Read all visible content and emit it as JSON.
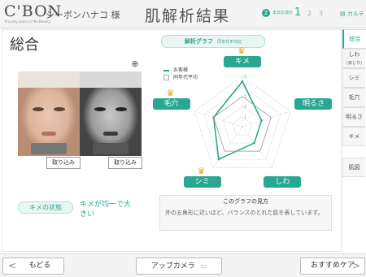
{
  "header": {
    "logo": "C'BON",
    "logo_sub": "It's only yours in the Beauty",
    "customer_name": "シーボンハナコ 様",
    "page_title": "肌解析結果",
    "step_label": "本日の流れ",
    "steps": [
      "1",
      "2",
      "3"
    ],
    "cart_label": "カルテ",
    "accent_color": "#2aa790"
  },
  "main": {
    "section_title": "総合",
    "photo_buttons": [
      "取り込み",
      "取り込み"
    ],
    "kime_badge": "キメの状態",
    "kime_result": "キメが均一で大きい"
  },
  "graph": {
    "header_title": "解析グラフ",
    "header_sub": "同年代平均比",
    "legend_customer": "お客様",
    "legend_average": "同年代平均",
    "explain_title": "このグラフの見方",
    "explain_body": "外の五角形に近いほど、バランスのとれた肌を表しています。"
  },
  "chart_data": {
    "type": "radar",
    "categories": [
      "キメ",
      "明るさ",
      "しわ",
      "シミ",
      "毛穴"
    ],
    "scale_labels": [
      "1",
      "2",
      "3",
      "4",
      "5"
    ],
    "range": [
      0,
      5
    ],
    "series": [
      {
        "name": "お客様",
        "values": [
          4.5,
          2.0,
          2.0,
          4.0,
          3.0
        ]
      },
      {
        "name": "同年代平均",
        "values": [
          3,
          3,
          3,
          3,
          3
        ]
      }
    ],
    "crowns": [
      "キメ",
      "シミ",
      "毛穴"
    ]
  },
  "side_tabs": [
    {
      "label": "総合",
      "active": true
    },
    {
      "label": "しわ",
      "sub": "(目じり)"
    },
    {
      "label": "シミ"
    },
    {
      "label": "毛穴"
    },
    {
      "label": "明るさ"
    },
    {
      "label": "キメ"
    },
    {
      "label": "肌図"
    }
  ],
  "footer": {
    "back_label": "もどる",
    "camera_label": "アップカメラ",
    "recommend_label": "おすすめケア"
  }
}
